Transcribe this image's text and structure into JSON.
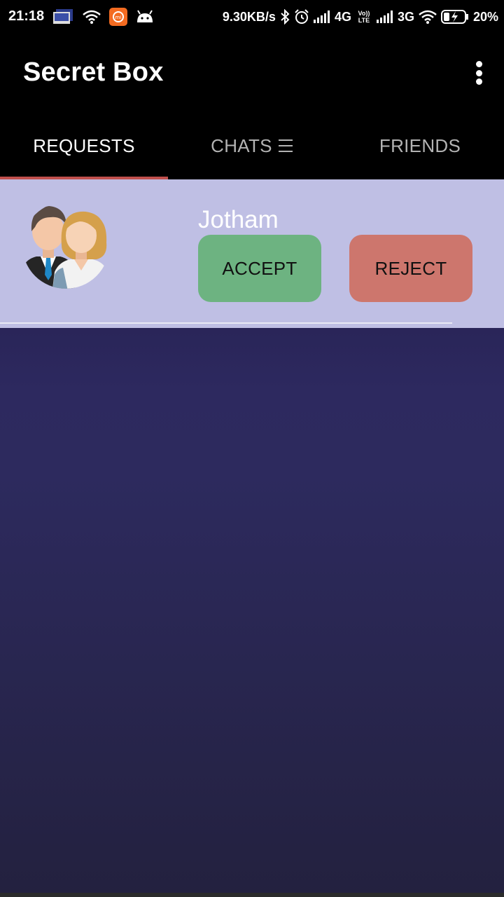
{
  "status_bar": {
    "time": "21:18",
    "net_speed": "9.30KB/s",
    "net_4g": "4G",
    "net_3g": "3G",
    "volte": "Vo)) LTE",
    "battery": "20%",
    "icons": [
      "image-notification-icon",
      "wifi-icon",
      "mi-app-icon",
      "android-icon",
      "bluetooth-icon",
      "alarm-icon",
      "signal-icon",
      "wifi-icon",
      "battery-charging-icon"
    ]
  },
  "app": {
    "title": "Secret Box",
    "menu_icon": "overflow-menu-icon"
  },
  "tabs": [
    {
      "label": "REQUESTS",
      "active": true
    },
    {
      "label": "CHATS",
      "active": false,
      "icon": "menu-lines-icon"
    },
    {
      "label": "FRIENDS",
      "active": false
    }
  ],
  "requests": [
    {
      "name": "Jotham",
      "avatar_icon": "couple-avatar-icon",
      "accept_label": "ACCEPT",
      "reject_label": "REJECT"
    }
  ],
  "colors": {
    "app_bar": "#000000",
    "tab_indicator": "#c0504d",
    "request_row": "#bfbfe4",
    "accept": "#6db381",
    "reject": "#cd766d",
    "background": "#2d295f"
  }
}
